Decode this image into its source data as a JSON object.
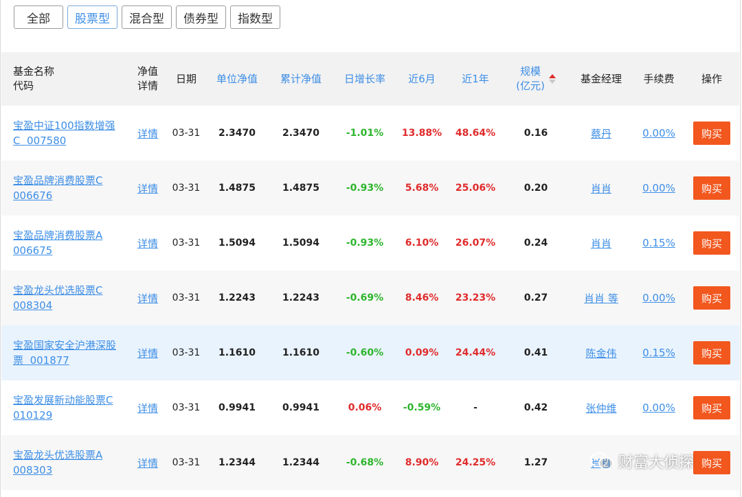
{
  "filters": [
    {
      "label": "全部",
      "active": false
    },
    {
      "label": "股票型",
      "active": true
    },
    {
      "label": "混合型",
      "active": false
    },
    {
      "label": "债券型",
      "active": false
    },
    {
      "label": "指数型",
      "active": false
    }
  ],
  "headers": {
    "name_line1": "基金名称",
    "name_line2": "代码",
    "detail_line1": "净值",
    "detail_line2": "详情",
    "date": "日期",
    "unit_nav": "单位净值",
    "accum_nav": "累计净值",
    "day_growth": "日增长率",
    "six_month": "近6月",
    "one_year": "近1年",
    "scale_line1": "规模",
    "scale_line2": "(亿元)",
    "manager": "基金经理",
    "fee": "手续费",
    "action": "操作"
  },
  "rows": [
    {
      "name": "宝盈中证100指数增强",
      "name2": "C",
      "code": "007580",
      "detail": "详情",
      "date": "03-31",
      "unit": "2.3470",
      "accum": "2.3470",
      "day": "-1.01%",
      "m6": "13.88%",
      "y1": "48.64%",
      "scale": "0.16",
      "manager": "蔡丹",
      "fee": "0.00%",
      "buy": "购买"
    },
    {
      "name": "宝盈品牌消费股票C",
      "name2": "",
      "code": "006676",
      "detail": "详情",
      "date": "03-31",
      "unit": "1.4875",
      "accum": "1.4875",
      "day": "-0.93%",
      "m6": "5.68%",
      "y1": "25.06%",
      "scale": "0.20",
      "manager": "肖肖",
      "fee": "0.00%",
      "buy": "购买"
    },
    {
      "name": "宝盈品牌消费股票A",
      "name2": "",
      "code": "006675",
      "detail": "详情",
      "date": "03-31",
      "unit": "1.5094",
      "accum": "1.5094",
      "day": "-0.93%",
      "m6": "6.10%",
      "y1": "26.07%",
      "scale": "0.24",
      "manager": "肖肖",
      "fee": "0.15%",
      "buy": "购买"
    },
    {
      "name": "宝盈龙头优选股票C",
      "name2": "",
      "code": "008304",
      "detail": "详情",
      "date": "03-31",
      "unit": "1.2243",
      "accum": "1.2243",
      "day": "-0.69%",
      "m6": "8.46%",
      "y1": "23.23%",
      "scale": "0.27",
      "manager": "肖肖 等",
      "fee": "0.00%",
      "buy": "购买"
    },
    {
      "name": "宝盈国家安全沪港深股",
      "name2": "票",
      "code": "001877",
      "detail": "详情",
      "date": "03-31",
      "unit": "1.1610",
      "accum": "1.1610",
      "day": "-0.60%",
      "m6": "0.09%",
      "y1": "24.44%",
      "scale": "0.41",
      "manager": "陈金伟",
      "fee": "0.15%",
      "buy": "购买"
    },
    {
      "name": "宝盈发展新动能股票C",
      "name2": "",
      "code": "010129",
      "detail": "详情",
      "date": "03-31",
      "unit": "0.9941",
      "accum": "0.9941",
      "day": "0.06%",
      "m6": "-0.59%",
      "y1": "-",
      "scale": "0.42",
      "manager": "张仲维",
      "fee": "0.00%",
      "buy": "购买"
    },
    {
      "name": "宝盈龙头优选股票A",
      "name2": "",
      "code": "008303",
      "detail": "详情",
      "date": "03-31",
      "unit": "1.2344",
      "accum": "1.2344",
      "day": "-0.68%",
      "m6": "8.90%",
      "y1": "24.25%",
      "scale": "1.27",
      "manager": "肖肖",
      "fee": "",
      "buy": "购买"
    }
  ],
  "colors": {
    "accent": "#3d8ee6",
    "gain": "#e02b2b",
    "loss": "#2db52d",
    "buy": "#f2571e"
  },
  "watermark": {
    "text": "财富大侦探",
    "icon": "wechat-icon"
  }
}
